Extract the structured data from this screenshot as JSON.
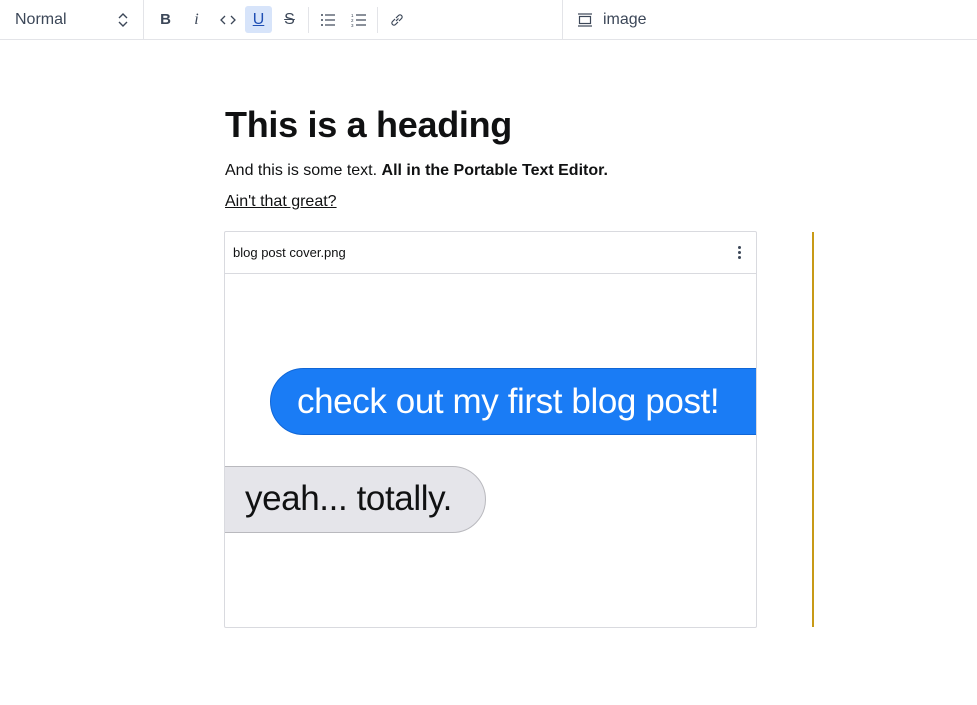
{
  "toolbar": {
    "block_style": "Normal",
    "bold_label": "B",
    "italic_label": "i",
    "code_label": "<>",
    "underline_label": "U",
    "strike_label": "S",
    "insert_label": "image",
    "underline_active": true
  },
  "content": {
    "heading": "This is a heading",
    "paragraph_text": "And this is some text.",
    "paragraph_bold": "All in the Portable Text Editor.",
    "link_text": "Ain't that great?",
    "image": {
      "filename": "blog post cover.png",
      "bubble_sent": "check out my first blog post!",
      "bubble_received": "yeah... totally."
    }
  },
  "colors": {
    "active_button_bg": "#d7e4fa",
    "bubble_blue": "#1a7cf5",
    "bubble_grey": "#e5e5ea",
    "focus_line": "#c89a16"
  }
}
